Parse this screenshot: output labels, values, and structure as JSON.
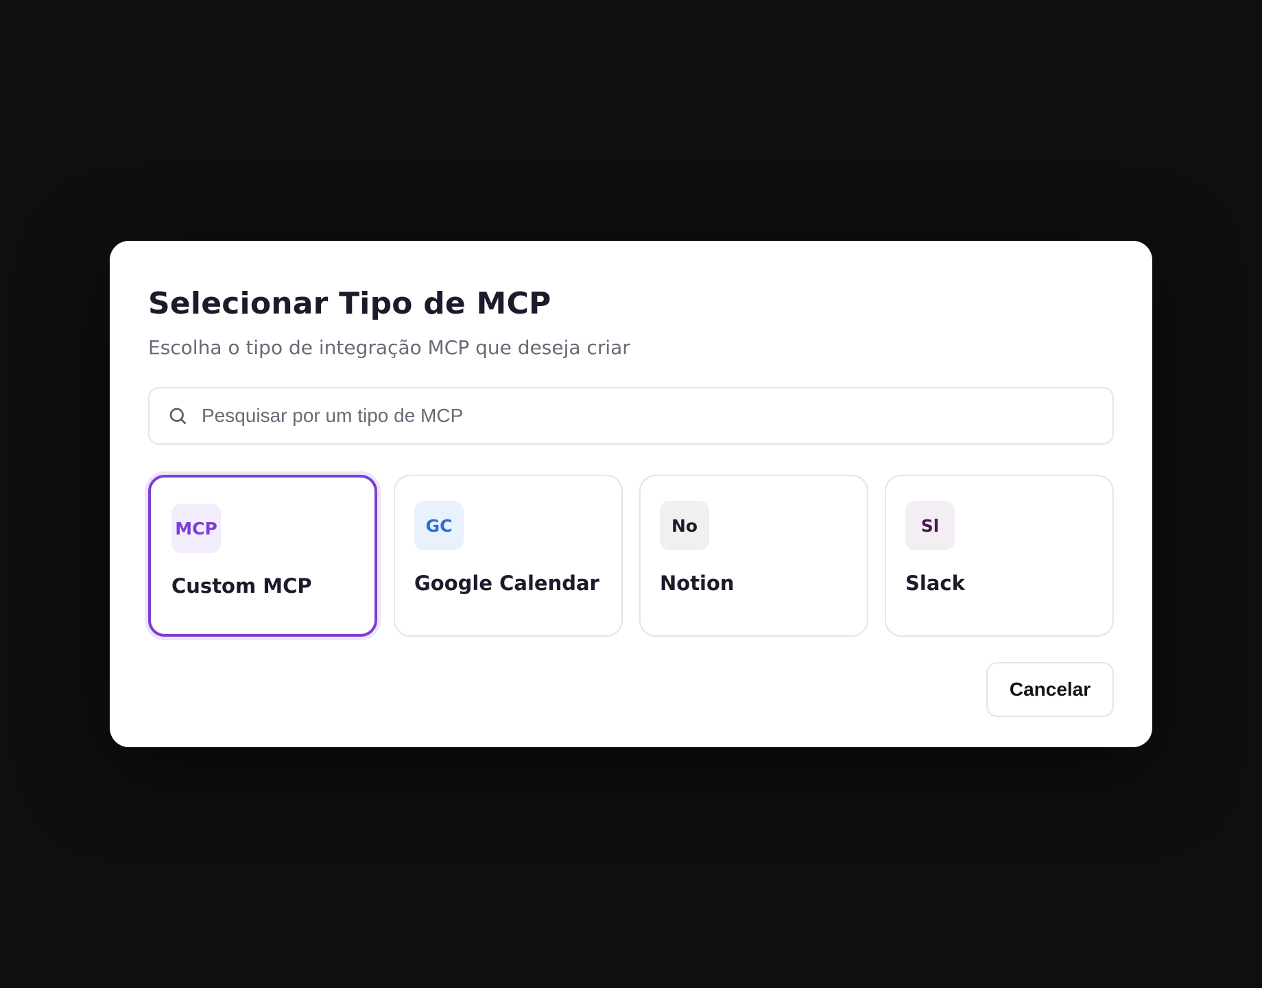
{
  "dialog": {
    "title": "Selecionar Tipo de MCP",
    "subtitle": "Escolha o tipo de integração MCP que deseja criar"
  },
  "search": {
    "placeholder": "Pesquisar por um tipo de MCP",
    "value": "",
    "icon": "search-icon"
  },
  "cards": [
    {
      "badge": "MCP",
      "label": "Custom MCP",
      "badge_color": "#7b3fd2",
      "badge_bg": "#f3ecfc",
      "selected": true
    },
    {
      "badge": "GC",
      "label": "Google Calendar",
      "badge_color": "#2b6fd6",
      "badge_bg": "#e9f1fd",
      "selected": false
    },
    {
      "badge": "No",
      "label": "Notion",
      "badge_color": "#1c1a2b",
      "badge_bg": "#f0f0f0",
      "selected": false
    },
    {
      "badge": "Sl",
      "label": "Slack",
      "badge_color": "#4a154b",
      "badge_bg": "#f3eef4",
      "selected": false
    }
  ],
  "footer": {
    "cancel_label": "Cancelar"
  },
  "colors": {
    "accent": "#7b3fd2",
    "backdrop": "#0f0f10",
    "dialog_bg": "#ffffff"
  }
}
